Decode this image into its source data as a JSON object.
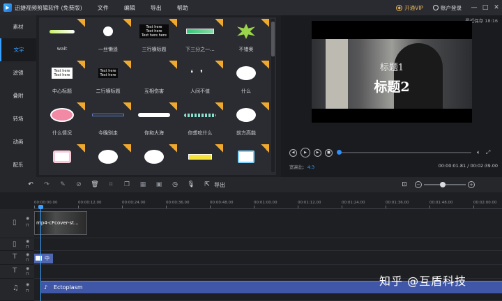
{
  "app": {
    "title": "迅捷视频剪辑软件 (免费版)",
    "menu": [
      "文件",
      "编辑",
      "导出",
      "帮助"
    ],
    "vip_label": "开通VIP",
    "account_label": "账户登录",
    "window_buttons": [
      "—",
      "□",
      "✕"
    ]
  },
  "sidebar": {
    "items": [
      {
        "label": "素材",
        "active": false
      },
      {
        "label": "文字",
        "active": true
      },
      {
        "label": "滤镜",
        "active": false
      },
      {
        "label": "叠附",
        "active": false
      },
      {
        "label": "转场",
        "active": false
      },
      {
        "label": "动画",
        "active": false
      },
      {
        "label": "配乐",
        "active": false
      }
    ]
  },
  "assets": {
    "items": [
      {
        "label": "wait",
        "style": "bar"
      },
      {
        "label": "一丝懒遥",
        "style": "bunny"
      },
      {
        "label": "三行横标题",
        "style": "dark3"
      },
      {
        "label": "下三分之一...",
        "style": "green"
      },
      {
        "label": "不错奥",
        "style": "burst"
      },
      {
        "label": "中心标题",
        "style": "white2"
      },
      {
        "label": "二行横标题",
        "style": "dark2"
      },
      {
        "label": "互相伤害",
        "style": "empty"
      },
      {
        "label": "人间不值",
        "style": "quote"
      },
      {
        "label": "什么",
        "style": "cloud"
      },
      {
        "label": "什么情况",
        "style": "pink"
      },
      {
        "label": "今晚别走",
        "style": "blueline"
      },
      {
        "label": "你和大海",
        "style": "pill"
      },
      {
        "label": "你想吃什么",
        "style": "dash"
      },
      {
        "label": "前方高能",
        "style": "cloud"
      },
      {
        "label": "",
        "style": "frame"
      },
      {
        "label": "",
        "style": "cloud"
      },
      {
        "label": "",
        "style": "cloud"
      },
      {
        "label": "",
        "style": "yellow"
      },
      {
        "label": "",
        "style": "tv"
      }
    ],
    "thumb_text": {
      "three_line": [
        "Text here",
        "Text here",
        "Text here here"
      ],
      "two_line": [
        "Text here",
        "Text here"
      ],
      "white_two": [
        "Text here",
        "Text here"
      ]
    }
  },
  "preview": {
    "autosave": "最近保存 18:16",
    "title1": "标题1",
    "title2": "标题2",
    "aspect_label": "宽高比:",
    "aspect_value": "4:3",
    "timecode": "00:00:01.81 / 00:02:39.00",
    "progress": 0.0
  },
  "timeline": {
    "export_label": "导出",
    "zoom": 0.45,
    "ruler": [
      "00:00:00.00",
      "00:00:12.00",
      "00:00:24.00",
      "00:00:36.00",
      "00:00:48.00",
      "00:01:00.00",
      "00:01:12.00",
      "00:01:24.00",
      "00:01:36.00",
      "00:01:48.00",
      "00:02:00.00"
    ],
    "video_clip": "mp4-cFcover-st...",
    "text_clip": "中",
    "audio_clip": "Ectoplasm"
  },
  "watermark": "知乎 @互盾科技",
  "colors": {
    "accent": "#3aa0ff",
    "badge": "#f0a92b",
    "vip": "#e8b65c",
    "audio_clip": "#4057a8",
    "text_clip": "#4f66b3"
  },
  "icons": {
    "play": "play-icon",
    "prev": "prev-frame-icon",
    "next": "next-frame-icon",
    "stop": "stop-icon",
    "volume": "volume-icon",
    "fullscreen": "fullscreen-icon"
  }
}
